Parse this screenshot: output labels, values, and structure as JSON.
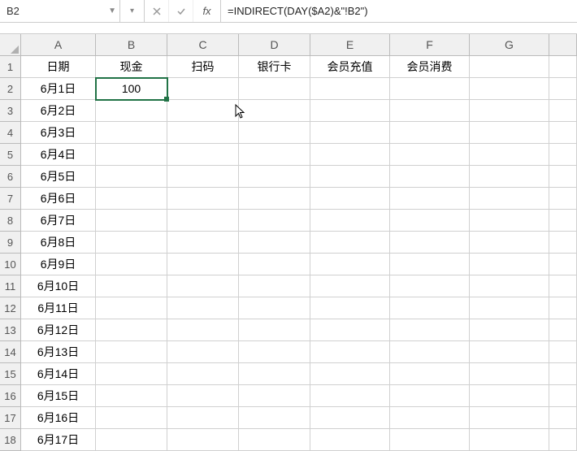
{
  "formula_bar": {
    "name_box": "B2",
    "fx_label": "fx",
    "formula": "=INDIRECT(DAY($A2)&\"!B2\")"
  },
  "columns": [
    "A",
    "B",
    "C",
    "D",
    "E",
    "F",
    "G"
  ],
  "row_numbers": [
    "1",
    "2",
    "3",
    "4",
    "5",
    "6",
    "7",
    "8",
    "9",
    "10",
    "11",
    "12",
    "13",
    "14",
    "15",
    "16",
    "17",
    "18"
  ],
  "headers": {
    "A": "日期",
    "B": "现金",
    "C": "扫码",
    "D": "银行卡",
    "E": "会员充值",
    "F": "会员消费",
    "G": ""
  },
  "dates": [
    "6月1日",
    "6月2日",
    "6月3日",
    "6月4日",
    "6月5日",
    "6月6日",
    "6月7日",
    "6月8日",
    "6月9日",
    "6月10日",
    "6月11日",
    "6月12日",
    "6月13日",
    "6月14日",
    "6月15日",
    "6月16日",
    "6月17日"
  ],
  "b2_value": "100",
  "selected_cell": "B2",
  "chart_data": {
    "type": "table",
    "columns": [
      "日期",
      "现金",
      "扫码",
      "银行卡",
      "会员充值",
      "会员消费"
    ],
    "rows": [
      [
        "6月1日",
        100,
        null,
        null,
        null,
        null
      ],
      [
        "6月2日",
        null,
        null,
        null,
        null,
        null
      ],
      [
        "6月3日",
        null,
        null,
        null,
        null,
        null
      ],
      [
        "6月4日",
        null,
        null,
        null,
        null,
        null
      ],
      [
        "6月5日",
        null,
        null,
        null,
        null,
        null
      ],
      [
        "6月6日",
        null,
        null,
        null,
        null,
        null
      ],
      [
        "6月7日",
        null,
        null,
        null,
        null,
        null
      ],
      [
        "6月8日",
        null,
        null,
        null,
        null,
        null
      ],
      [
        "6月9日",
        null,
        null,
        null,
        null,
        null
      ],
      [
        "6月10日",
        null,
        null,
        null,
        null,
        null
      ],
      [
        "6月11日",
        null,
        null,
        null,
        null,
        null
      ],
      [
        "6月12日",
        null,
        null,
        null,
        null,
        null
      ],
      [
        "6月13日",
        null,
        null,
        null,
        null,
        null
      ],
      [
        "6月14日",
        null,
        null,
        null,
        null,
        null
      ],
      [
        "6月15日",
        null,
        null,
        null,
        null,
        null
      ],
      [
        "6月16日",
        null,
        null,
        null,
        null,
        null
      ],
      [
        "6月17日",
        null,
        null,
        null,
        null,
        null
      ]
    ]
  }
}
